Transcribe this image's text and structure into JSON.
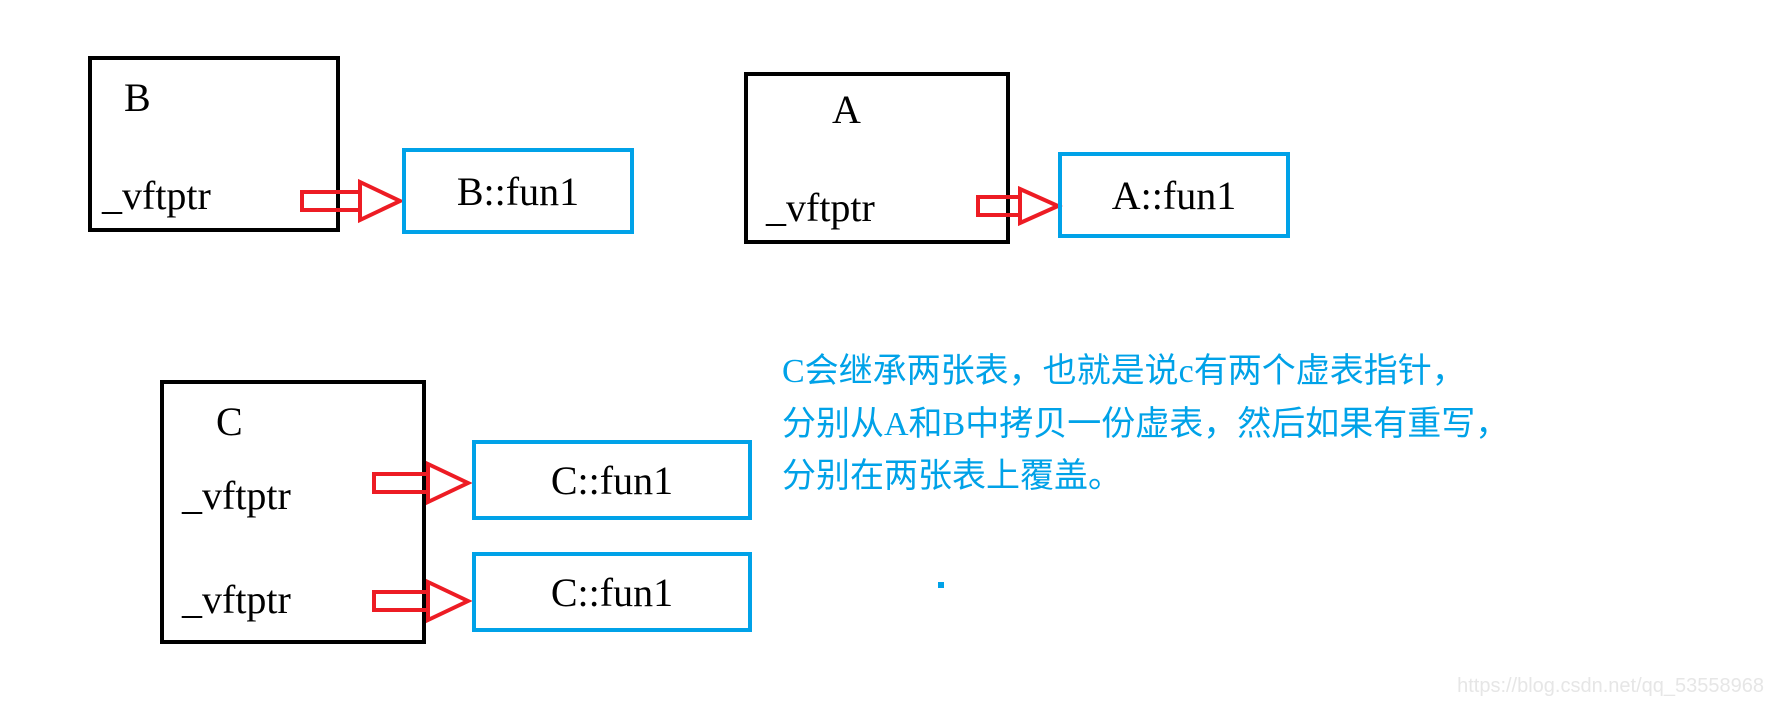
{
  "boxes": {
    "B": {
      "title": "B",
      "ptr": "_vftptr",
      "vtable": "B::fun1"
    },
    "A": {
      "title": "A",
      "ptr": "_vftptr",
      "vtable": "A::fun1"
    },
    "C": {
      "title": "C",
      "ptr1": "_vftptr",
      "ptr2": "_vftptr",
      "vtable1": "C::fun1",
      "vtable2": "C::fun1"
    }
  },
  "explanation": {
    "line1": "C会继承两张表，也就是说c有两个虚表指针，",
    "line2": "分别从A和B中拷贝一份虚表，然后如果有重写，",
    "line3": "分别在两张表上覆盖。"
  },
  "watermark": "https://blog.csdn.net/qq_53558968"
}
